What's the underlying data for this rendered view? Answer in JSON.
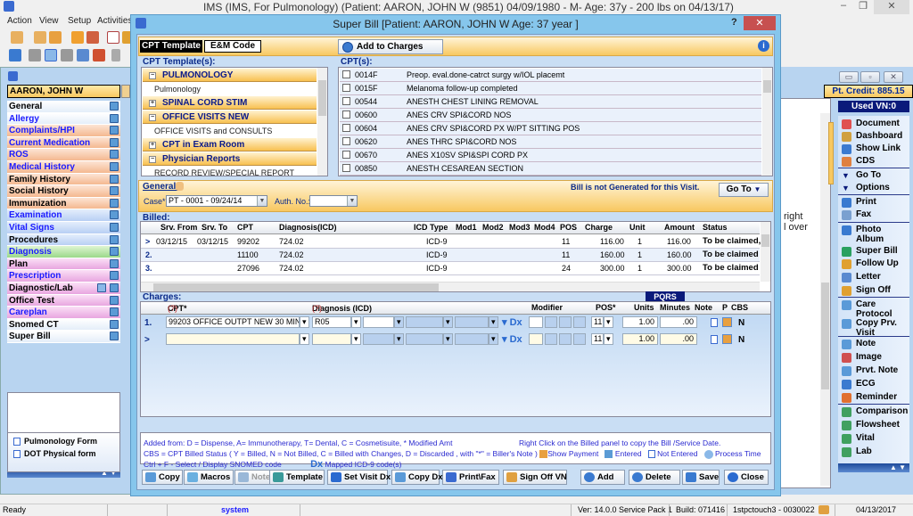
{
  "main_window": {
    "title": "IMS (IMS, For Pulmonology)    (Patient: AARON, JOHN W (9851) 04/09/1980 - M- Age: 37y  - 200 lbs on 04/13/17)",
    "controls": [
      "–",
      "❐",
      "✕"
    ]
  },
  "menu": [
    "Action",
    "View",
    "Setup",
    "Activities"
  ],
  "left_panel": {
    "patient_name": "AARON, JOHN W",
    "nav_items": [
      {
        "label": "General",
        "color": "white",
        "blue": false
      },
      {
        "label": "Allergy",
        "color": "white",
        "blue": true
      },
      {
        "label": "Complaints/HPI",
        "color": "orange",
        "blue": true
      },
      {
        "label": "Current Medication",
        "color": "orange",
        "blue": true
      },
      {
        "label": "ROS",
        "color": "orange",
        "blue": true
      },
      {
        "label": "Medical History",
        "color": "orange",
        "blue": true
      },
      {
        "label": "Family History",
        "color": "orange",
        "blue": false
      },
      {
        "label": "Social History",
        "color": "orange",
        "blue": false
      },
      {
        "label": "Immunization",
        "color": "orange",
        "blue": false
      },
      {
        "label": "Examination",
        "color": "blue",
        "blue": true
      },
      {
        "label": "Vital Signs",
        "color": "blue",
        "blue": true
      },
      {
        "label": "Procedures",
        "color": "blue",
        "blue": false
      },
      {
        "label": "Diagnosis",
        "color": "green",
        "blue": true
      },
      {
        "label": "Plan",
        "color": "pink",
        "blue": false
      },
      {
        "label": "Prescription",
        "color": "pink",
        "blue": true
      },
      {
        "label": "Diagnostic/Lab",
        "color": "pink",
        "blue": false
      },
      {
        "label": "Office Test",
        "color": "pink",
        "blue": false
      },
      {
        "label": "Careplan",
        "color": "pink",
        "blue": true
      },
      {
        "label": "Snomed CT",
        "color": "white",
        "blue": false
      },
      {
        "label": "Super Bill",
        "color": "white",
        "blue": false
      }
    ],
    "forms": [
      "Pulmonology Form",
      "DOT Physical form"
    ]
  },
  "right_panel": {
    "pt_credit": "Pt. Credit: 885.15",
    "used_vn": "Used VN:0",
    "background_text": [
      "right",
      "l over"
    ],
    "menu_items": [
      {
        "label": "Document",
        "icon": "document-icon",
        "color": "#e05050"
      },
      {
        "label": "Dashboard",
        "icon": "dashboard-icon",
        "color": "#d0a040"
      },
      {
        "label": "Show Link",
        "icon": "link-icon",
        "color": "#3a7ad0"
      },
      {
        "label": "CDS",
        "icon": "cds-icon",
        "color": "#e08040"
      },
      {
        "label": "Go To",
        "icon": "triangle-down-icon",
        "color": "#0a1a7a"
      },
      {
        "label": "Options",
        "icon": "triangle-down-icon",
        "color": "#0a1a7a"
      },
      {
        "label": "Print",
        "icon": "print-icon",
        "color": "#3a7ad0"
      },
      {
        "label": "Fax",
        "icon": "fax-icon",
        "color": "#7aa0d0"
      },
      {
        "label": "Photo Album",
        "icon": "photo-album-icon",
        "color": "#3a7ad0"
      },
      {
        "label": "Super Bill",
        "icon": "super-bill-icon",
        "color": "#2aa060"
      },
      {
        "label": "Follow Up",
        "icon": "calendar-icon",
        "color": "#e0a030"
      },
      {
        "label": "Letter",
        "icon": "letter-icon",
        "color": "#5a8ad0"
      },
      {
        "label": "Sign Off",
        "icon": "sign-off-icon",
        "color": "#e0a030"
      },
      {
        "label": "Care Protocol",
        "icon": "care-protocol-icon",
        "color": "#5a9ad8"
      },
      {
        "label": "Copy Prv. Visit",
        "icon": "copy-visit-icon",
        "color": "#5a9ad8"
      },
      {
        "label": "Note",
        "icon": "note-icon",
        "color": "#5a9ad8"
      },
      {
        "label": "Image",
        "icon": "image-icon",
        "color": "#d05050"
      },
      {
        "label": "Prvt. Note",
        "icon": "private-note-icon",
        "color": "#5a9ad8"
      },
      {
        "label": "ECG",
        "icon": "ecg-icon",
        "color": "#3a7ad0"
      },
      {
        "label": "Reminder",
        "icon": "reminder-icon",
        "color": "#e07030"
      },
      {
        "label": "Comparison",
        "icon": "comparison-icon",
        "color": "#40a060"
      },
      {
        "label": "Flowsheet",
        "icon": "flowsheet-icon",
        "color": "#40a060"
      },
      {
        "label": "Vital",
        "icon": "vital-icon",
        "color": "#40a060"
      },
      {
        "label": "Lab",
        "icon": "lab-icon",
        "color": "#40a060"
      }
    ]
  },
  "dialog": {
    "title": "Super Bill  [Patient: AARON, JOHN W  Age: 37 year ]",
    "help": "?",
    "close": "✕",
    "tabs": [
      "CPT Template",
      "E&M Code"
    ],
    "add_to_charges": "Add to Charges",
    "templates_label": "CPT Template(s):",
    "templates": [
      {
        "header": "PULMONOLOGY",
        "expanded": true,
        "children": [
          "Pulmonology"
        ]
      },
      {
        "header": "SPINAL CORD STIM",
        "expanded": false,
        "children": []
      },
      {
        "header": "OFFICE VISITS NEW",
        "expanded": true,
        "children": [
          "OFFICE VISITS and CONSULTS"
        ]
      },
      {
        "header": "CPT in Exam Room",
        "expanded": false,
        "children": []
      },
      {
        "header": "Physician Reports",
        "expanded": true,
        "children": [
          "RECORD REVIEW/SPECIAL REPORT"
        ]
      }
    ],
    "cpts_label": "CPT(s):",
    "cpts": [
      {
        "code": "0014F",
        "desc": "Preop. eval.done-catrct surgy w/IOL placemt"
      },
      {
        "code": "0015F",
        "desc": "Melanoma follow-up completed"
      },
      {
        "code": "00544",
        "desc": "ANESTH CHEST LINING REMOVAL"
      },
      {
        "code": "00600",
        "desc": "ANES CRV SPI&CORD NOS"
      },
      {
        "code": "00604",
        "desc": "ANES CRV SPI&CORD PX W/PT SITTING POS"
      },
      {
        "code": "00620",
        "desc": "ANES THRC SPI&CORD NOS"
      },
      {
        "code": "00670",
        "desc": "ANES X10SV SPI&SPI CORD PX"
      },
      {
        "code": "00850",
        "desc": "ANESTH CESAREAN SECTION"
      }
    ],
    "general": {
      "label": "General:",
      "case_label": "Case*",
      "case_value": "PT  -  0001 - 09/24/14",
      "auth_label": "Auth. No.:",
      "auth_value": "",
      "bill_status": "Bill is not Generated for this Visit.",
      "goto": "Go To"
    },
    "billed": {
      "label": "Billed:",
      "columns": [
        "Srv. From",
        "Srv. To",
        "CPT",
        "Diagnosis(ICD)",
        "ICD Type",
        "Mod1",
        "Mod2",
        "Mod3",
        "Mod4",
        "POS",
        "Charge",
        "Unit",
        "Amount",
        "Status"
      ],
      "rows": [
        {
          "marker": ">",
          "from": "03/12/15",
          "to": "03/12/15",
          "cpt": "99202",
          "dx": "724.02",
          "icd_type": "ICD-9",
          "pos": "11",
          "charge": "116.00",
          "unit": "1",
          "amount": "116.00",
          "status": "To be claimed, S"
        },
        {
          "marker": "2.",
          "from": "",
          "to": "",
          "cpt": "11100",
          "dx": "724.02",
          "icd_type": "ICD-9",
          "pos": "11",
          "charge": "160.00",
          "unit": "1",
          "amount": "160.00",
          "status": "To be claimed"
        },
        {
          "marker": "3.",
          "from": "",
          "to": "",
          "cpt": "27096",
          "dx": "724.02",
          "icd_type": "ICD-9",
          "pos": "24",
          "charge": "300.00",
          "unit": "1",
          "amount": "300.00",
          "status": "To be claimed"
        }
      ]
    },
    "charges": {
      "label": "Charges:",
      "pqrs": "PQRS",
      "columns": {
        "cpt": "CPT*",
        "cpt_help": "(?)",
        "dx": "Diagnosis (ICD)",
        "dx_help": "(?)",
        "modifier": "Modifier",
        "pos": "POS*",
        "units": "Units",
        "minutes": "Minutes",
        "note": "Note",
        "p": "P",
        "cbs": "CBS"
      },
      "rows": [
        {
          "marker": "1.",
          "cpt": "99203     OFFICE OUTPT NEW 30 MIN",
          "dx1": "R05",
          "pos": "11",
          "units": "1.00",
          "minutes": ".00",
          "cbs": "N"
        },
        {
          "marker": ">",
          "cpt": "",
          "dx1": "",
          "pos": "11",
          "units": "1.00",
          "minutes": ".00",
          "cbs": "N"
        }
      ]
    },
    "legend": {
      "line1": "Added from: D = Dispense, A= Immunotherapy, T= Dental,  C = Cosmetisuite,   * Modified Amt",
      "line1_right": "Right Click on the Billed panel to copy the Bill /Service Date.",
      "line2": "CBS = CPT Billed Status ( Y = Billed, N = Not Billed, C = Billed with Changes, D = Discarded , with \"*\" = Biller's Note )",
      "show_payment": "Show Payment",
      "entered": "Entered",
      "not_entered": "Not Entered",
      "process_time": "Process Time",
      "line3": "Ctrl + F - Select / Display SNOMED code",
      "mapped": "Mapped ICD-9 code(s)",
      "dx_glyph": "Dx"
    },
    "buttons": [
      {
        "label": "Copy",
        "name": "copy-button",
        "icon": "copy-icon",
        "disabled": false
      },
      {
        "label": "Macros",
        "name": "macros-button",
        "icon": "macros-icon",
        "disabled": false
      },
      {
        "label": "Note",
        "name": "note-button",
        "icon": "note-icon",
        "disabled": true
      },
      {
        "label": "Template",
        "name": "template-button",
        "icon": "template-icon",
        "disabled": false
      },
      {
        "label": "Set Visit Dx",
        "name": "set-visit-dx-button",
        "icon": "dx-icon",
        "disabled": false
      },
      {
        "label": "Copy Dx",
        "name": "copy-dx-button",
        "icon": "copy-icon",
        "disabled": false
      },
      {
        "label": "Print\\Fax",
        "name": "print-fax-button",
        "icon": "print-icon",
        "disabled": false
      },
      {
        "label": "Sign Off VN",
        "name": "sign-off-vn-button",
        "icon": "sign-off-icon",
        "disabled": false
      },
      {
        "label": "Add",
        "name": "add-button",
        "icon": "add-icon",
        "disabled": false
      },
      {
        "label": "Delete",
        "name": "delete-button",
        "icon": "delete-icon",
        "disabled": false
      },
      {
        "label": "Save",
        "name": "save-button",
        "icon": "save-icon",
        "disabled": false
      },
      {
        "label": "Close",
        "name": "close-button",
        "icon": "close-icon",
        "disabled": false
      }
    ]
  },
  "status_bar": {
    "status": "Ready",
    "user": "system",
    "version": "Ver: 14.0.0 Service Pack 1",
    "build": "Build: 071416",
    "station": "1stpctouch3 - 0030022",
    "date": "04/13/2017"
  }
}
